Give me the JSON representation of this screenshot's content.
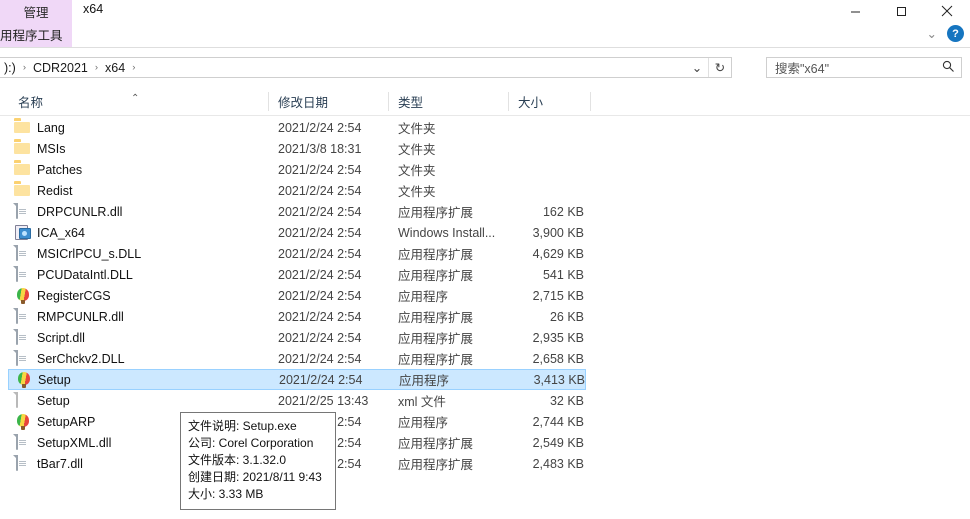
{
  "window": {
    "context_tab_label": "管理",
    "context_subtab_label": "用程序工具",
    "title": "x64",
    "minimize_label": "—",
    "maximize_label": "□",
    "close_label": "✕",
    "help_label": "?",
    "ribbon_collapse_label": "⌄"
  },
  "address_bar": {
    "crumbs": [
      {
        "label": "):)"
      },
      {
        "label": "CDR2021"
      },
      {
        "label": "x64"
      }
    ],
    "separator": "›",
    "dropdown_icon": "⌄",
    "refresh_icon": "↻"
  },
  "search": {
    "placeholder": "搜索\"x64\"",
    "value": "搜索\"x64\"",
    "icon": "search-icon"
  },
  "columns": {
    "name": "名称",
    "date": "修改日期",
    "type": "类型",
    "size": "大小",
    "sort_caret": "⌃"
  },
  "files": [
    {
      "name": "Lang",
      "date": "2021/2/24 2:54",
      "type": "文件夹",
      "size": "",
      "icon": "folder-icon",
      "selected": false
    },
    {
      "name": "MSIs",
      "date": "2021/3/8 18:31",
      "type": "文件夹",
      "size": "",
      "icon": "folder-icon",
      "selected": false
    },
    {
      "name": "Patches",
      "date": "2021/2/24 2:54",
      "type": "文件夹",
      "size": "",
      "icon": "folder-icon",
      "selected": false
    },
    {
      "name": "Redist",
      "date": "2021/2/24 2:54",
      "type": "文件夹",
      "size": "",
      "icon": "folder-icon",
      "selected": false
    },
    {
      "name": "DRPCUNLR.dll",
      "date": "2021/2/24 2:54",
      "type": "应用程序扩展",
      "size": "162 KB",
      "icon": "dll-icon",
      "selected": false
    },
    {
      "name": "ICA_x64",
      "date": "2021/2/24 2:54",
      "type": "Windows Install...",
      "size": "3,900 KB",
      "icon": "msi-icon",
      "selected": false
    },
    {
      "name": "MSICrlPCU_s.DLL",
      "date": "2021/2/24 2:54",
      "type": "应用程序扩展",
      "size": "4,629 KB",
      "icon": "dll-icon",
      "selected": false
    },
    {
      "name": "PCUDataIntl.DLL",
      "date": "2021/2/24 2:54",
      "type": "应用程序扩展",
      "size": "541 KB",
      "icon": "dll-icon",
      "selected": false
    },
    {
      "name": "RegisterCGS",
      "date": "2021/2/24 2:54",
      "type": "应用程序",
      "size": "2,715 KB",
      "icon": "corel-icon",
      "selected": false
    },
    {
      "name": "RMPCUNLR.dll",
      "date": "2021/2/24 2:54",
      "type": "应用程序扩展",
      "size": "26 KB",
      "icon": "dll-icon",
      "selected": false
    },
    {
      "name": "Script.dll",
      "date": "2021/2/24 2:54",
      "type": "应用程序扩展",
      "size": "2,935 KB",
      "icon": "dll-icon",
      "selected": false
    },
    {
      "name": "SerChckv2.DLL",
      "date": "2021/2/24 2:54",
      "type": "应用程序扩展",
      "size": "2,658 KB",
      "icon": "dll-icon",
      "selected": false
    },
    {
      "name": "Setup",
      "date": "2021/2/24 2:54",
      "type": "应用程序",
      "size": "3,413 KB",
      "icon": "corel-icon",
      "selected": true
    },
    {
      "name": "Setup",
      "date": "2021/2/25 13:43",
      "type": "xml 文件",
      "size": "32 KB",
      "icon": "xml-doc-icon",
      "selected": false
    },
    {
      "name": "SetupARP",
      "date": "2021/2/24 2:54",
      "type": "应用程序",
      "size": "2,744 KB",
      "icon": "corel-icon",
      "selected": false
    },
    {
      "name": "SetupXML.dll",
      "date": "2021/2/24 2:54",
      "type": "应用程序扩展",
      "size": "2,549 KB",
      "icon": "dll-icon",
      "selected": false
    },
    {
      "name": "tBar7.dll",
      "date": "2021/2/24 2:54",
      "type": "应用程序扩展",
      "size": "2,483 KB",
      "icon": "dll-icon",
      "selected": false
    }
  ],
  "tooltip": {
    "lines": [
      "文件说明: Setup.exe",
      "公司: Corel Corporation",
      "文件版本: 3.1.32.0",
      "创建日期: 2021/8/11 9:43",
      "大小: 3.33 MB"
    ]
  },
  "colors": {
    "selection": "#cce8ff",
    "context_tab": "#f0d8f7",
    "folder": "#fbd170",
    "help_blue": "#1675c0"
  }
}
